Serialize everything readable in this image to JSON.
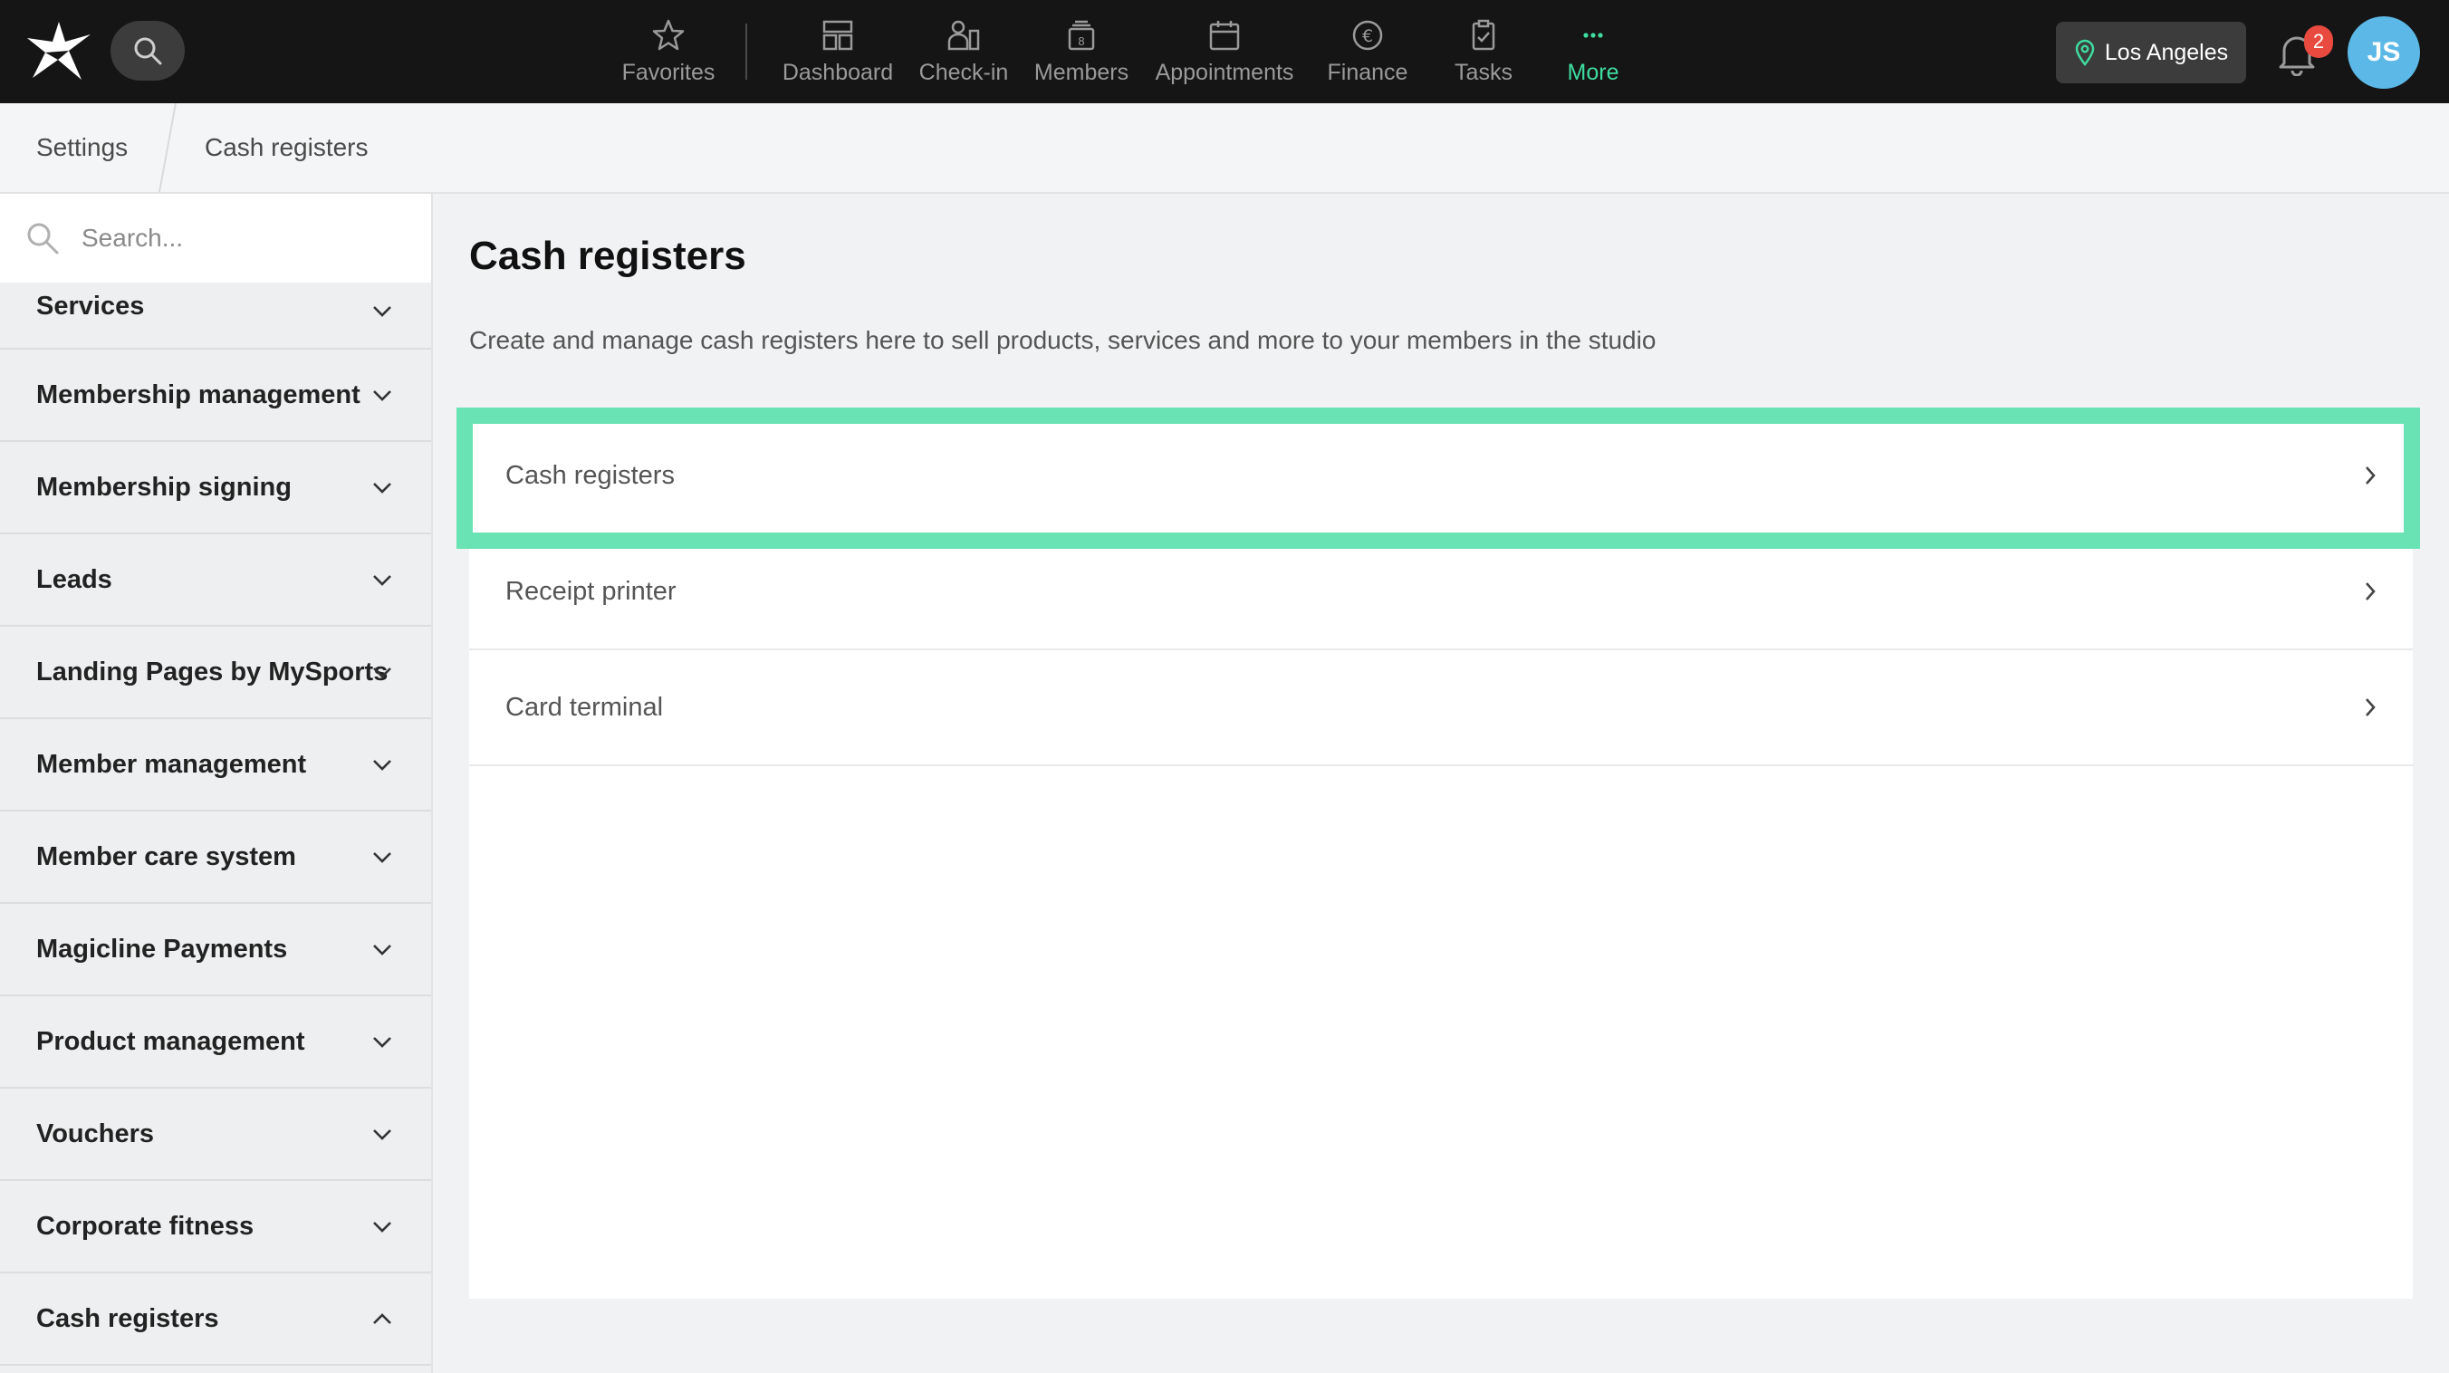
{
  "topbar": {
    "nav": [
      {
        "label": "Favorites",
        "icon": "star-icon"
      },
      {
        "label": "Dashboard",
        "icon": "dashboard-icon"
      },
      {
        "label": "Check-in",
        "icon": "check-in-icon"
      },
      {
        "label": "Members",
        "icon": "members-icon"
      },
      {
        "label": "Appointments",
        "icon": "calendar-icon"
      },
      {
        "label": "Finance",
        "icon": "euro-icon"
      },
      {
        "label": "Tasks",
        "icon": "clipboard-icon"
      },
      {
        "label": "More",
        "icon": "more-icon"
      }
    ],
    "location": "Los Angeles",
    "notification_count": "2",
    "avatar_initials": "JS",
    "active_color": "#3fdca0"
  },
  "breadcrumb": {
    "items": [
      "Settings",
      "Cash registers"
    ]
  },
  "sidebar": {
    "search_placeholder": "Search...",
    "items": [
      {
        "label": "Services",
        "expanded": false
      },
      {
        "label": "Membership management",
        "expanded": false
      },
      {
        "label": "Membership signing",
        "expanded": false
      },
      {
        "label": "Leads",
        "expanded": false
      },
      {
        "label": "Landing Pages by MySports",
        "expanded": false
      },
      {
        "label": "Member management",
        "expanded": false
      },
      {
        "label": "Member care system",
        "expanded": false
      },
      {
        "label": "Magicline Payments",
        "expanded": false
      },
      {
        "label": "Product management",
        "expanded": false
      },
      {
        "label": "Vouchers",
        "expanded": false
      },
      {
        "label": "Corporate fitness",
        "expanded": false
      },
      {
        "label": "Cash registers",
        "expanded": true
      }
    ]
  },
  "main": {
    "title": "Cash registers",
    "description": "Create and manage cash registers here to sell products, services and more to your members in the studio",
    "rows": [
      {
        "label": "Cash registers",
        "highlighted": true
      },
      {
        "label": "Receipt printer"
      },
      {
        "label": "Card terminal"
      }
    ],
    "highlight_color": "#6ae3b4"
  }
}
